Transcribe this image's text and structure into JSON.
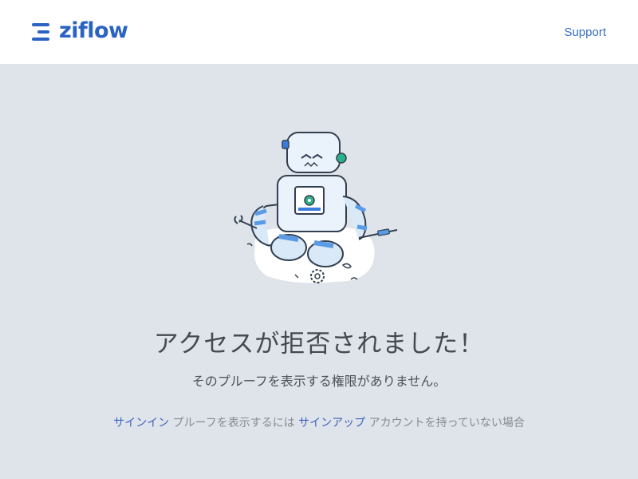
{
  "header": {
    "logo_text": "ziflow",
    "support_label": "Support"
  },
  "colors": {
    "brand": "#2a63c2",
    "link": "#3f64c0",
    "background": "#dfe3ea",
    "header_bg": "#ffffff"
  },
  "main": {
    "illustration": "robot-repair-illustration",
    "title": "アクセスが拒否されました！",
    "subtitle": "そのプルーフを表示する権限がありません。",
    "signin_link": "サインイン",
    "signin_suffix": "プルーフを表示するには",
    "signup_link": "サインアップ",
    "signup_suffix": "アカウントを持っていない場合"
  }
}
